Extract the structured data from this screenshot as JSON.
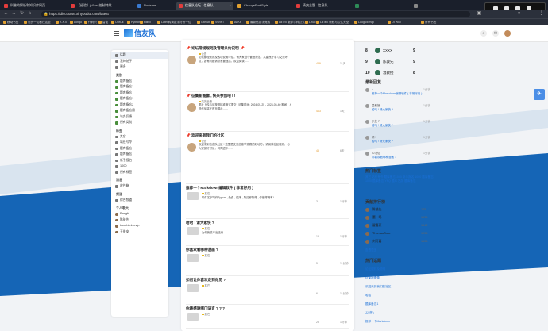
{
  "browser": {
    "tabs": [
      {
        "label": "科普的解析和知识库网页...",
        "active": false
      },
      {
        "label": "【经验】js&css控制特效...",
        "active": false
      },
      {
        "label": "Node.ms",
        "active": false
      },
      {
        "label": "信息队论坛 - 信息队",
        "active": true
      },
      {
        "label": "ChangeFontStyle",
        "active": false
      },
      {
        "label": "清爽主题 - 信息队",
        "active": false
      },
      {
        "label": "",
        "active": false
      },
      {
        "label": "",
        "active": false
      }
    ],
    "url": "https://discourse.xinyoudui.com/latest",
    "bookmarks": [
      "移动书签",
      "您的一切都在这里",
      "X.X.X",
      "Longo",
      "代码识",
      "智能",
      "OhrOk",
      "Python",
      "bilibili",
      "Latex转换数学符号一位",
      "GitHub",
      "SWIFT",
      "AI Kit",
      "最新信息学竞赛",
      "LaTeX 数学学科公式",
      "Linux",
      "LaTeX 教程与公式大全",
      "Luogu/Emoji",
      "OI Wiki",
      "所有书签"
    ],
    "popup_text": "正在共享: 信息队·前夜场"
  },
  "header": {
    "logo_text": "信友队",
    "icons": [
      "search-icon",
      "chat-icon",
      "user-icon"
    ]
  },
  "sidebar": {
    "items_top": [
      {
        "label": "话题",
        "active": true
      },
      {
        "label": "我的帖子"
      },
      {
        "label": "更多"
      }
    ],
    "categories_title": "类别",
    "categories": [
      "题库备忘",
      "题库备忘1",
      "题库备忘",
      "题库备忘1",
      "题库备忘2",
      "题库备忘用",
      "站务反馈",
      "所有类别"
    ],
    "tags_title": "标签",
    "tags": [
      "其它",
      "站长号令",
      "题库备忘",
      "题库备忘",
      "新手报名",
      "1000",
      "所有标签"
    ],
    "messages_title": "消息",
    "messages": [
      "收件箱"
    ],
    "channels_title": "频道",
    "channels": [
      "综合频道"
    ],
    "dm_title": "个人聊天",
    "dms": [
      "Rangfu",
      "陈骏先",
      "boochimba.vip",
      "王俊安"
    ]
  },
  "topics": [
    {
      "title": "📌 论坛常规规则及管理条约说明 📌",
      "category": "公告",
      "excerpt": "论坛管理规则及各项说明介绍。请大家遵守管理规范，共建良好学习交流环境，如有问题请联系管理员。欢迎阅读……",
      "replies": "489",
      "age": "11天",
      "hot": true
    },
    {
      "title": "📌 征集新图像 , 快来参加吧 ! !",
      "category": "站务反馈",
      "excerpt": "图片上传后请按照标准格式提交 , 征集时间: 2024-05-25 - 2024-05-40 期间 , 入选作品将在首页展示……",
      "replies": "463",
      "age": "1天",
      "hot": true
    },
    {
      "title": "📌 欢迎来到我们的社区 !",
      "category": "公告",
      "excerpt": "欢迎来到信友队社区 ! 这里是交流信息学竞赛的好地方。请阅读社区准则，与大家友好讨论，共同进步……",
      "replies": "45",
      "age": "6天",
      "hot": true
    },
    {
      "title": "推荐一个Markdown编辑软件 ( 非常好用 )",
      "category": "其它",
      "excerpt": "软件名字叫作Typora , 免费 , 纯净 , 所见即所得 , 你值得拥有 !",
      "replies": "3",
      "age": "1分钟",
      "hot": false
    },
    {
      "title": "哈哈 ! 请大家快 ?",
      "category": "其它",
      "excerpt": "为何我说不出话来",
      "replies": "13",
      "age": "1分钟",
      "hot": false
    },
    {
      "title": "你喜欢看哪种漫画 ?",
      "category": "其它",
      "excerpt": "",
      "replies": "5",
      "age": "11分钟",
      "hot": false
    },
    {
      "title": "如何让你喜欢走到你见 ?",
      "category": "其它",
      "excerpt": "",
      "replies": "6",
      "age": "11分钟",
      "hot": false
    },
    {
      "title": "你最感谢哪门语言 ? ? ?",
      "category": "其它",
      "excerpt": "",
      "replies": "23",
      "age": "1分钟",
      "hot": false
    }
  ],
  "right": {
    "ranks": [
      {
        "n": "8",
        "name": "XXXX",
        "score": "9"
      },
      {
        "n": "9",
        "name": "陈骏先",
        "score": "9"
      },
      {
        "n": "10",
        "name": "温教授",
        "score": "8"
      }
    ],
    "recent_title": "最新回复",
    "recent": [
      {
        "name": "k",
        "topic": "推荐一个Markdown编辑软件 ( 非常好用 )",
        "date": "1分钟"
      },
      {
        "name": "温教授",
        "topic": "哈哈 ! 请大家快 ?",
        "date": "1分钟"
      },
      {
        "name": "乐友 7",
        "topic": "哈哈 ! 请大家快 ?",
        "date": "1分钟"
      },
      {
        "name": "晴 !",
        "topic": "哈哈 ! 请大家快 ?",
        "date": "1分钟"
      },
      {
        "name": "JJ (的)",
        "topic": "你喜欢看哪种漫画 ?",
        "date": "1分钟"
      }
    ],
    "hot_title": "热门标签",
    "hot_text": "其它 站长号令 题库备忘1000 新手报名 1000 题库备忘1000 题库备忘 YFQ 题库 站务 题库备忘",
    "leaderboard_title": "贡献排行榜",
    "leaderboard": [
      {
        "name": "陈骏先",
        "value": "175"
      },
      {
        "name": "董一鸣",
        "value": "1935"
      },
      {
        "name": "翟嘉豪",
        "value": "1542"
      },
      {
        "name": "ThomasZhao",
        "value": "1256"
      },
      {
        "name": "刘可嘉",
        "value": "1456"
      }
    ],
    "more_label": "查看更多",
    "popular_title": "热门话题",
    "popular": [
      "论坛规则及说明",
      "征集新图像",
      "欢迎来到我们的社区",
      "哈哈 !",
      "题库备忘1",
      "JJ (的)",
      "推荐一个Markdown"
    ]
  }
}
